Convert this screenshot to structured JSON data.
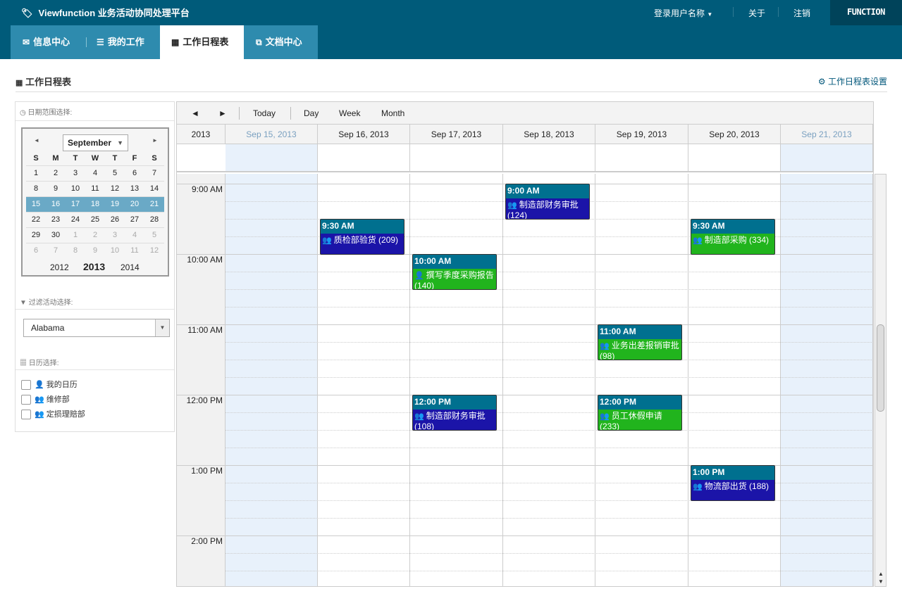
{
  "app": {
    "title": "Viewfunction 业务活动协同处理平台",
    "brand": "FUNCTION"
  },
  "topbar": {
    "user": "登录用户名称",
    "about": "关于",
    "logout": "注销"
  },
  "nav": {
    "tabs": [
      {
        "label": "信息中心",
        "icon": "envelope-icon"
      },
      {
        "label": "我的工作",
        "icon": "list-icon"
      },
      {
        "label": "工作日程表",
        "icon": "calendar-icon",
        "active": true
      },
      {
        "label": "文档中心",
        "icon": "documents-icon"
      }
    ]
  },
  "page": {
    "title": "工作日程表",
    "settings": "工作日程表设置"
  },
  "sidebar": {
    "date_range_label": "日期范围选择:",
    "filter_label": "过滤活动选择:",
    "calendar_label": "日历选择:",
    "filter_value": "Alabama",
    "calendars": [
      "我的日历",
      "维修部",
      "定损理赔部"
    ]
  },
  "minical": {
    "month": "September",
    "dow": [
      "S",
      "M",
      "T",
      "W",
      "T",
      "F",
      "S"
    ],
    "weeks": [
      [
        "1",
        "2",
        "3",
        "4",
        "5",
        "6",
        "7"
      ],
      [
        "8",
        "9",
        "10",
        "11",
        "12",
        "13",
        "14"
      ],
      [
        "15",
        "16",
        "17",
        "18",
        "19",
        "20",
        "21"
      ],
      [
        "22",
        "23",
        "24",
        "25",
        "26",
        "27",
        "28"
      ],
      [
        "29",
        "30",
        "1",
        "2",
        "3",
        "4",
        "5"
      ],
      [
        "6",
        "7",
        "8",
        "9",
        "10",
        "11",
        "12"
      ]
    ],
    "years": [
      "2012",
      "2013",
      "2014"
    ]
  },
  "toolbar": {
    "prev": "◄",
    "next": "►",
    "today": "Today",
    "day": "Day",
    "week": "Week",
    "month": "Month"
  },
  "header": {
    "year": "2013",
    "days": [
      "Sep 15, 2013",
      "Sep 16, 2013",
      "Sep 17, 2013",
      "Sep 18, 2013",
      "Sep 19, 2013",
      "Sep 20, 2013",
      "Sep 21, 2013"
    ]
  },
  "times": [
    "9:00 AM",
    "10:00 AM",
    "11:00 AM",
    "12:00 PM",
    "1:00 PM",
    "2:00 PM"
  ],
  "events": [
    {
      "day": 3,
      "time": "9:00 AM",
      "title": "制造部财务审批",
      "count": "(124)",
      "color": "blue",
      "icon": "group-icon"
    },
    {
      "day": 1,
      "time": "9:30 AM",
      "title": "质检部验货 (209)",
      "count": "",
      "color": "blue",
      "icon": "group-icon"
    },
    {
      "day": 5,
      "time": "9:30 AM",
      "title": "制造部采购 (334)",
      "count": "",
      "color": "green",
      "icon": "group-icon"
    },
    {
      "day": 2,
      "time": "10:00 AM",
      "title": "撰写季度采购报告",
      "count": "(140)",
      "color": "green",
      "icon": "user-icon"
    },
    {
      "day": 4,
      "time": "11:00 AM",
      "title": "业务出差报销审批",
      "count": "(98)",
      "color": "green",
      "icon": "group-icon"
    },
    {
      "day": 2,
      "time": "12:00 PM",
      "title": "制造部财务审批",
      "count": "(108)",
      "color": "blue",
      "icon": "group-icon"
    },
    {
      "day": 4,
      "time": "12:00 PM",
      "title": "员工休假申请",
      "count": "(233)",
      "color": "green",
      "icon": "group-icon"
    },
    {
      "day": 5,
      "time": "1:00 PM",
      "title": "物流部出货 (188)",
      "count": "",
      "color": "blue",
      "icon": "group-icon"
    }
  ]
}
